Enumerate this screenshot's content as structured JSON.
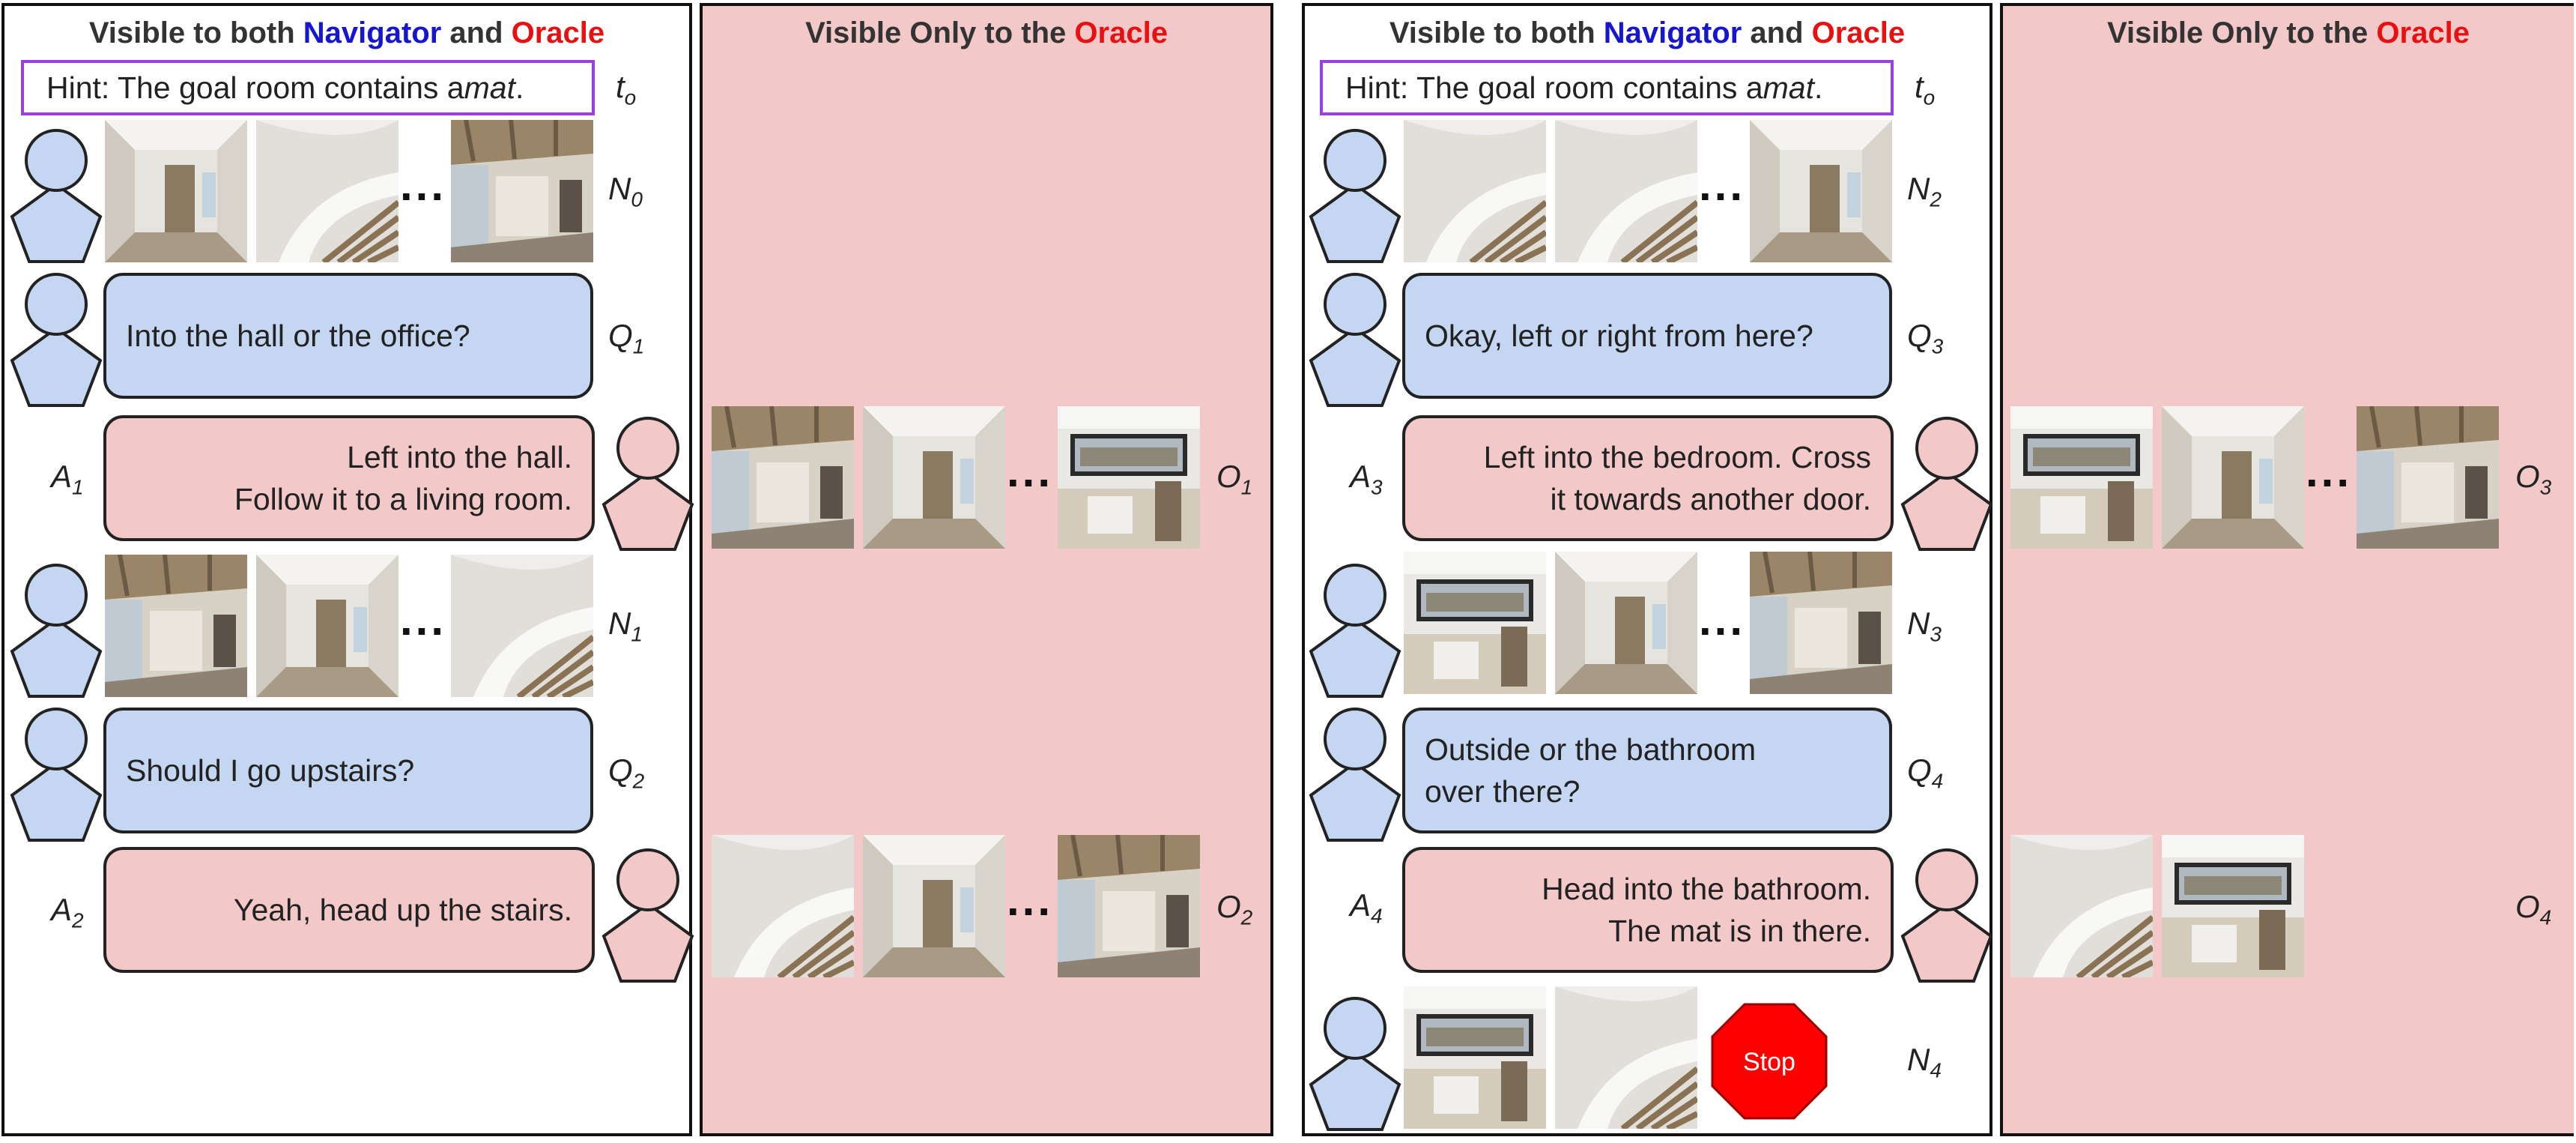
{
  "panels": {
    "both_title": {
      "pre": "Visible to both ",
      "navigator": "Navigator",
      "mid": " and ",
      "oracle": "Oracle"
    },
    "oracle_title": {
      "pre": "Visible Only to the ",
      "oracle": "Oracle"
    }
  },
  "colors": {
    "navigator_text": "#1616d0",
    "oracle_text": "#e81010",
    "navigator_fill": "#c5d6f2",
    "oracle_fill": "#f2c8c8",
    "hint_border": "#9a3fe0",
    "stop": "#ff0000"
  },
  "hint": {
    "pre": "Hint: The goal room contains a ",
    "word": "mat",
    "post": "."
  },
  "labels": {
    "t": "t",
    "t_sub": "o",
    "N0": "N",
    "N0_sub": "0",
    "N1": "N",
    "N1_sub": "1",
    "N2": "N",
    "N2_sub": "2",
    "N3": "N",
    "N3_sub": "3",
    "N4": "N",
    "N4_sub": "4",
    "Q1": "Q",
    "Q1_sub": "1",
    "Q2": "Q",
    "Q2_sub": "2",
    "Q3": "Q",
    "Q3_sub": "3",
    "Q4": "Q",
    "Q4_sub": "4",
    "A1": "A",
    "A1_sub": "1",
    "A2": "A",
    "A2_sub": "2",
    "A3": "A",
    "A3_sub": "3",
    "A4": "A",
    "A4_sub": "4",
    "O1": "O",
    "O1_sub": "1",
    "O2": "O",
    "O2_sub": "2",
    "O3": "O",
    "O3_sub": "3",
    "O4": "O",
    "O4_sub": "4"
  },
  "dialogue": {
    "q1": "Into the hall or the office?",
    "a1_line1": "Left into the hall.",
    "a1_line2": "Follow it to a living room.",
    "q2": "Should I go upstairs?",
    "a2": "Yeah, head up the stairs.",
    "q3": "Okay, left or right from here?",
    "a3_line1": "Left into the bedroom. Cross",
    "a3_line2": "it towards another door.",
    "q4_line1": "Outside or the bathroom",
    "q4_line2": "over there?",
    "a4_line1": "Head into the bathroom.",
    "a4_line2": "The mat is in there."
  },
  "ellipsis": "...",
  "stop_label": "Stop",
  "icons": {
    "navigator": "navigator-avatar-icon",
    "oracle": "oracle-avatar-icon",
    "stop": "stop-sign-icon",
    "frame": "panorama-frame-image"
  }
}
